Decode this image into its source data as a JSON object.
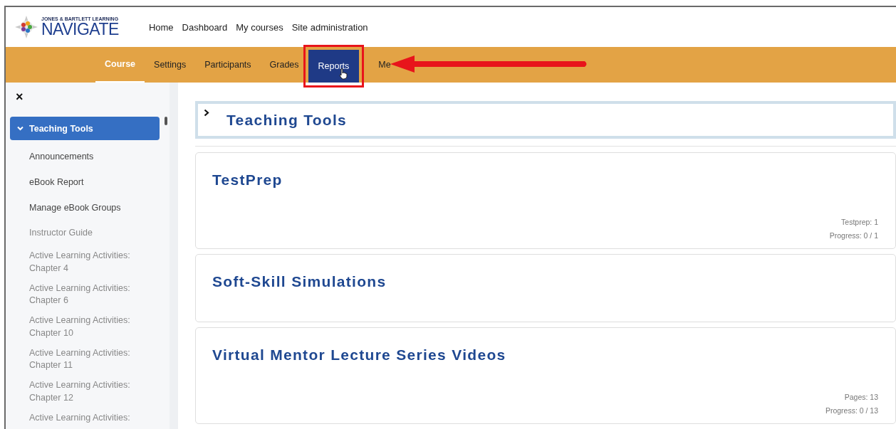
{
  "header": {
    "logo": {
      "publisher": "JONES & BARTLETT LEARNING",
      "name": "NAVIGATE"
    },
    "links": [
      "Home",
      "Dashboard",
      "My courses",
      "Site administration"
    ]
  },
  "course_nav": {
    "tabs": [
      {
        "label": "Course",
        "selected": true,
        "hovered": false
      },
      {
        "label": "Settings",
        "selected": false,
        "hovered": false
      },
      {
        "label": "Participants",
        "selected": false,
        "hovered": false
      },
      {
        "label": "Grades",
        "selected": false,
        "hovered": false
      },
      {
        "label": "Reports",
        "selected": false,
        "hovered": true
      },
      {
        "label": "Me",
        "selected": false,
        "hovered": false
      }
    ]
  },
  "sidebar": {
    "close": "×",
    "section": {
      "label": "Teaching Tools",
      "expanded": true,
      "selected": true
    },
    "items": [
      {
        "label": "Announcements",
        "dimmed": false
      },
      {
        "label": "eBook Report",
        "dimmed": false
      },
      {
        "label": "Manage eBook Groups",
        "dimmed": false
      },
      {
        "label": "Instructor Guide",
        "dimmed": true
      },
      {
        "label": "Active Learning Activities: Chapter 4",
        "dimmed": true
      },
      {
        "label": "Active Learning Activities: Chapter 6",
        "dimmed": true
      },
      {
        "label": "Active Learning Activities: Chapter 10",
        "dimmed": true
      },
      {
        "label": "Active Learning Activities: Chapter 11",
        "dimmed": true
      },
      {
        "label": "Active Learning Activities: Chapter 12",
        "dimmed": true
      },
      {
        "label": "Active Learning Activities:",
        "dimmed": true
      }
    ]
  },
  "main": {
    "collapsed_section": {
      "title": "Teaching Tools",
      "expanded": false
    },
    "cards": [
      {
        "title": "TestPrep",
        "meta": [
          "Testprep: 1",
          "Progress: 0 / 1"
        ]
      },
      {
        "title": "Soft-Skill Simulations"
      },
      {
        "title": "Virtual Mentor Lecture Series Videos",
        "meta": [
          "Pages: 13",
          "Progress: 0 / 13"
        ]
      }
    ]
  }
}
